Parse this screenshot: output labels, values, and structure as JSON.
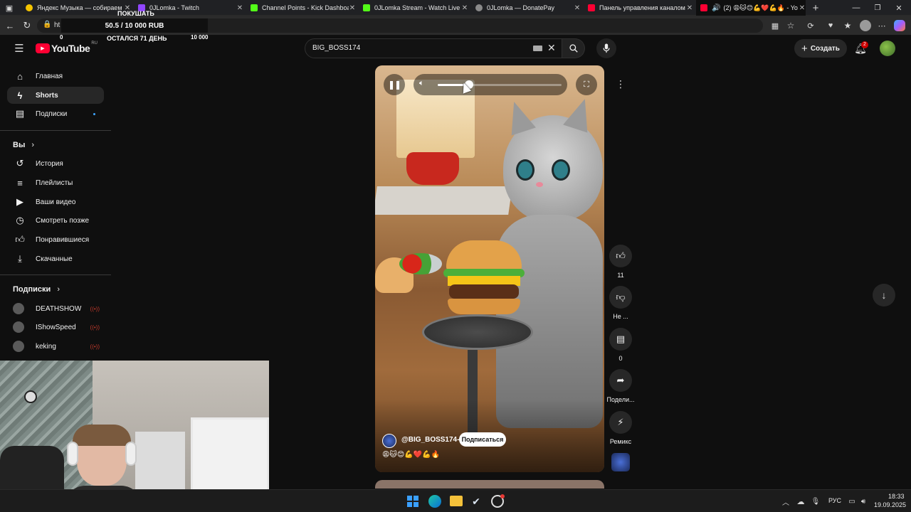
{
  "browser": {
    "tabs": [
      {
        "title": "Яндекс Музыка — собираем му",
        "color": "#f5c400"
      },
      {
        "title": "0JLomka - Twitch",
        "color": "#9146ff"
      },
      {
        "title": "Channel Points - Kick Dashboard",
        "color": "#53fc18"
      },
      {
        "title": "0JLomka Stream - Watch Live on",
        "color": "#53fc18"
      },
      {
        "title": "0JLomka — DonatePay",
        "color": "#8a8a8a"
      },
      {
        "title": "Панель управления каналом - Y",
        "color": "#ff0033"
      },
      {
        "title": "(2) 😩🐱😊💪❤️💪🔥 - Yo",
        "color": "#ff0033"
      }
    ],
    "url_fragment": "ht",
    "new_tab": "+"
  },
  "overlay": {
    "label_top": "ПОКУШАТЬ",
    "amount": "50.5 / 10 000 RUB",
    "min": "0",
    "max": "10 000",
    "remaining": "ОСТАЛСЯ 71 ДЕНЬ"
  },
  "youtube": {
    "logo": "YouTube",
    "region": "RU",
    "search_value": "BIG_BOSS174",
    "create_label": "Создать",
    "notif_count": "2"
  },
  "sidebar": {
    "main": [
      {
        "label": "Главная",
        "icon": "home-icon"
      },
      {
        "label": "Shorts",
        "icon": "shorts-icon"
      },
      {
        "label": "Подписки",
        "icon": "subscriptions-icon"
      }
    ],
    "you_title": "Вы",
    "you": [
      {
        "label": "История",
        "icon": "history-icon"
      },
      {
        "label": "Плейлисты",
        "icon": "playlists-icon"
      },
      {
        "label": "Ваши видео",
        "icon": "your-videos-icon"
      },
      {
        "label": "Смотреть позже",
        "icon": "watch-later-icon"
      },
      {
        "label": "Понравившиеся",
        "icon": "liked-icon"
      },
      {
        "label": "Скачанные",
        "icon": "downloads-icon"
      }
    ],
    "subs_title": "Подписки",
    "subs": [
      {
        "label": "DEATHSHOW"
      },
      {
        "label": "IShowSpeed"
      },
      {
        "label": "keking"
      }
    ]
  },
  "short": {
    "channel": "@BIG_BOSS174-1",
    "subscribe": "Подписаться",
    "caption": "😩🐱😊💪❤️💪🔥",
    "volume": 0.25,
    "likes": "11",
    "dislike": "Не ...",
    "comments": "0",
    "share": "Подели...",
    "remix": "Ремикс"
  },
  "taskbar": {
    "lang": "РУС",
    "time": "18:33",
    "date": "19.09.2025"
  }
}
